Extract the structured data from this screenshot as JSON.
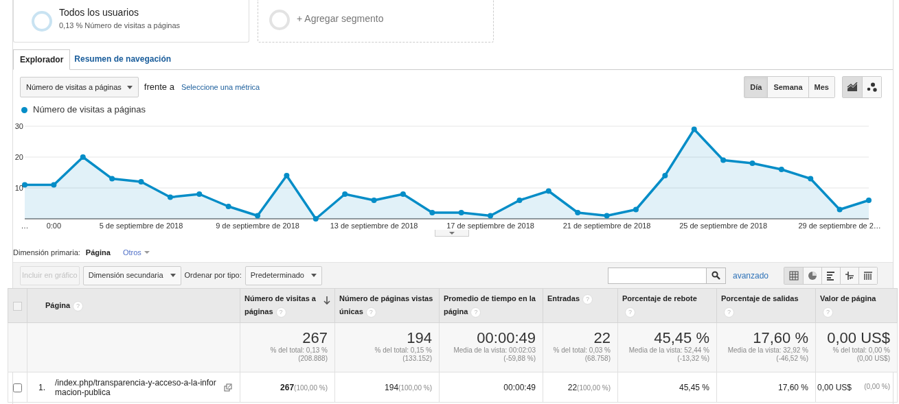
{
  "segments": [
    {
      "kind": "active",
      "title": "Todos los usuarios",
      "subtitle": "0,13 % Número de visitas a páginas"
    },
    {
      "kind": "add",
      "title": "+ Agregar segmento"
    }
  ],
  "tabs": [
    {
      "label": "Explorador",
      "selected": true
    },
    {
      "label": "Resumen de navegación",
      "selected": false
    }
  ],
  "metric_bar": {
    "metric": "Número de visitas a páginas",
    "versus": "frente a",
    "select_link": "Seleccione una métrica"
  },
  "period_buttons": [
    {
      "label": "Día",
      "selected": true
    },
    {
      "label": "Semana",
      "selected": false
    },
    {
      "label": "Mes",
      "selected": false
    }
  ],
  "chart_type_buttons": [
    {
      "kind": "line",
      "selected": true
    },
    {
      "kind": "motion",
      "selected": false
    }
  ],
  "chart": {
    "chart_data": {
      "type": "area",
      "grid": true,
      "ylim": [
        0,
        30
      ],
      "yticks": [
        10,
        20,
        30
      ],
      "categories": [
        "…",
        "0:00",
        null,
        null,
        "5 de septiembre de 2018",
        null,
        null,
        null,
        "9 de septiembre de 2018",
        null,
        null,
        null,
        "13 de septiembre de 2018",
        null,
        null,
        null,
        "17 de septiembre de 2018",
        null,
        null,
        null,
        "21 de septiembre de 2018",
        null,
        null,
        null,
        "25 de septiembre de 2018",
        null,
        null,
        null,
        "29 de septiembre de 2…",
        null
      ],
      "series": [
        {
          "name": "Número de visitas a páginas",
          "color": "#058dc7",
          "values": [
            11,
            11,
            20,
            13,
            12,
            7,
            8,
            4,
            1,
            14,
            0,
            8,
            6,
            8,
            2,
            2,
            1,
            6,
            9,
            2,
            1,
            3,
            14,
            29,
            19,
            18,
            16,
            13,
            3,
            6
          ]
        }
      ]
    }
  },
  "dimension_bar": {
    "label": "Dimensión primaria:",
    "current": "Página",
    "other": "Otros"
  },
  "toolbar": {
    "plot_button": "Incluir en gráfico",
    "secondary": "Dimensión secundaria",
    "sort_label": "Ordenar por tipo:",
    "sort_value": "Predeterminado",
    "advanced": "avanzado"
  },
  "view_buttons": [
    {
      "kind": "table",
      "selected": true
    },
    {
      "kind": "pie",
      "selected": false
    },
    {
      "kind": "bars",
      "selected": false
    },
    {
      "kind": "compare",
      "selected": false
    },
    {
      "kind": "pivot",
      "selected": false
    }
  ],
  "table": {
    "columns": [
      {
        "kind": "checkbox",
        "checked": false
      },
      {
        "label": "Página",
        "help": "?",
        "sorted": false
      },
      {
        "label": "Número de visitas a páginas",
        "help": "?",
        "sorted": true
      },
      {
        "label": "Número de páginas vistas únicas",
        "help": "?",
        "sorted": false
      },
      {
        "label": "Promedio de tiempo en la página",
        "help": "?",
        "sorted": false
      },
      {
        "label": "Entradas",
        "help": "?",
        "sorted": false
      },
      {
        "label": "Porcentaje de rebote",
        "help": "?",
        "sorted": false
      },
      {
        "label": "Porcentaje de salidas",
        "help": "?",
        "sorted": false
      },
      {
        "label": "Valor de página",
        "help": "?",
        "sorted": false
      }
    ],
    "totals": [
      {
        "value": "267",
        "note": "% del total: 0,13 %",
        "base": "(208.888)"
      },
      {
        "value": "194",
        "note": "% del total: 0,15 %",
        "base": "(133.152)"
      },
      {
        "value": "00:00:49",
        "note": "Media de la vista: 00:02:03",
        "base": "(-59,88 %)"
      },
      {
        "value": "22",
        "note": "% del total: 0,03 %",
        "base": "(68.758)"
      },
      {
        "value": "45,45 %",
        "note": "Media de la vista: 52,44 %",
        "base": "(-13,32 %)"
      },
      {
        "value": "17,60 %",
        "note": "Media de la vista: 32,92 %",
        "base": "(-46,52 %)"
      },
      {
        "value": "0,00 US$",
        "note": "% del total: 0,00 %",
        "base": "(0,00 US$)"
      }
    ],
    "rows": [
      {
        "cells": [
          {
            "kind": "checkbox",
            "checked": false
          },
          {
            "kind": "page",
            "index": "1.",
            "page": "/index.php/transparencia-y-acceso-a-la-informacion-publica"
          },
          {
            "value": "267",
            "share": "(100,00 %)",
            "bold": true
          },
          {
            "value": "194",
            "share": "(100,00 %)",
            "bold": false
          },
          {
            "value": "00:00:49",
            "bold": false
          },
          {
            "value": "22",
            "share": "(100,00 %)",
            "bold": false
          },
          {
            "value": "45,45 %",
            "bold": false
          },
          {
            "value": "17,60 %",
            "bold": false
          },
          {
            "value": "0,00 US$",
            "share": "(0,00 %)",
            "bold": false
          }
        ]
      }
    ]
  }
}
